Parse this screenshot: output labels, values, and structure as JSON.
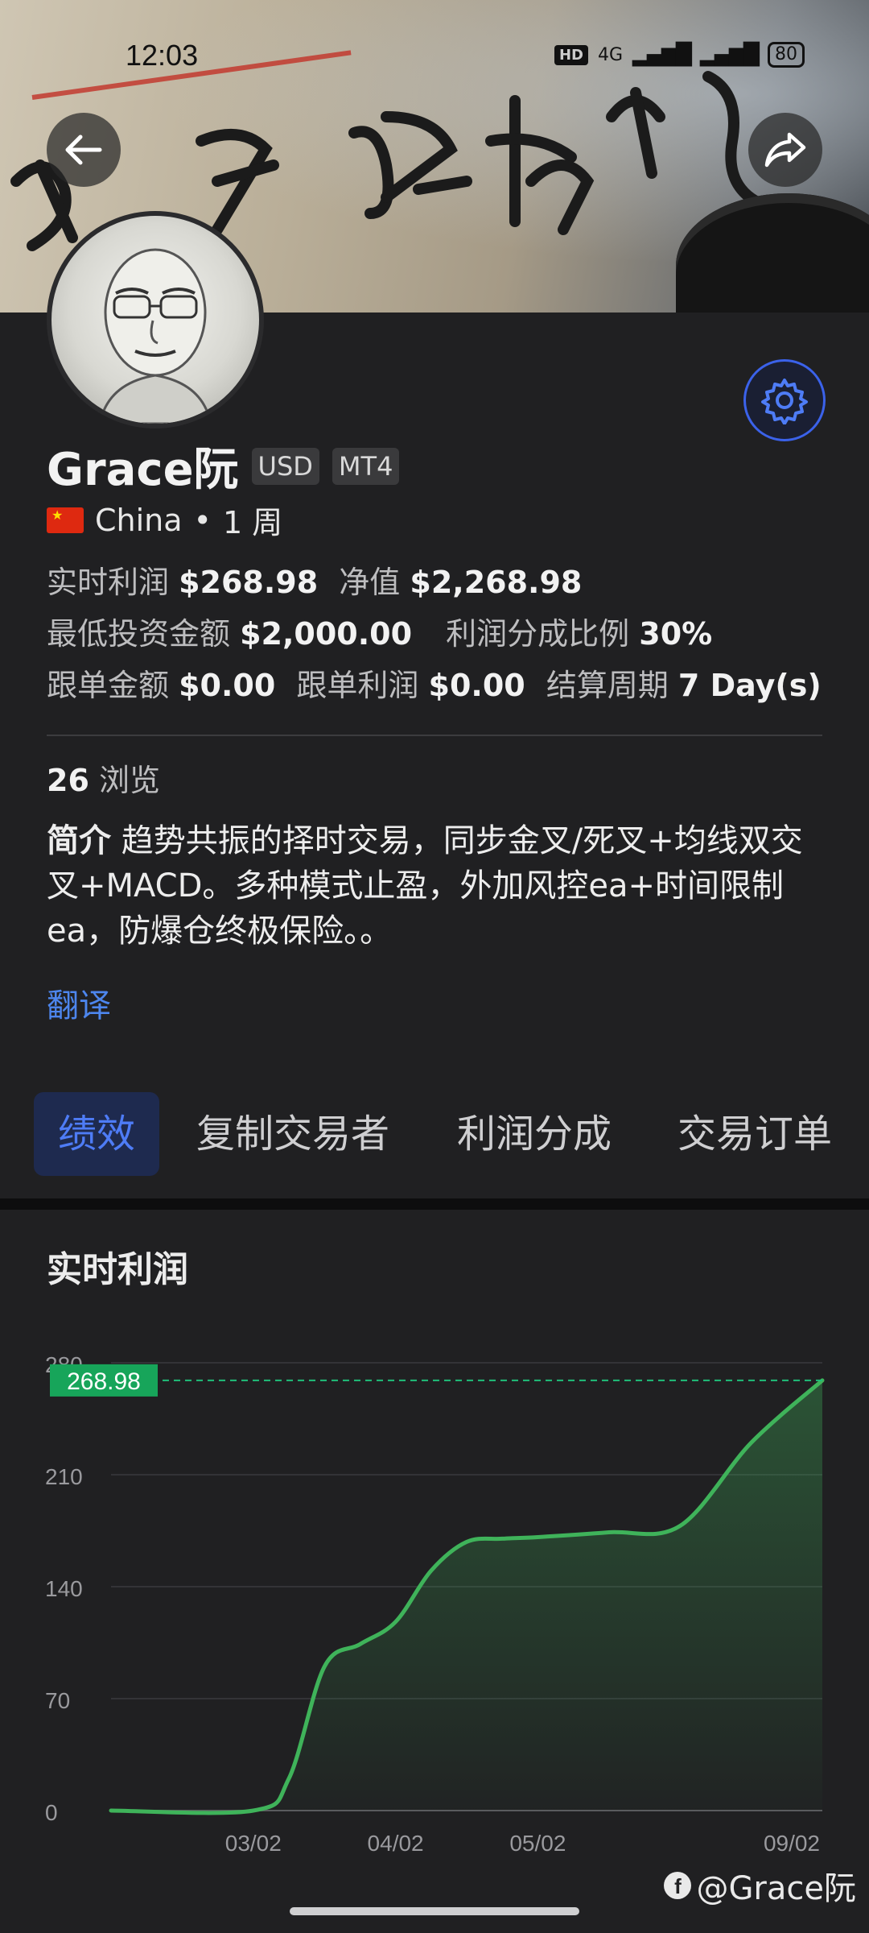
{
  "status_bar": {
    "time": "12:03",
    "network_badge": "HD",
    "signal_label": "4G",
    "battery": "80"
  },
  "profile": {
    "name": "Grace阮",
    "tags": [
      "USD",
      "MT4"
    ],
    "country": "China",
    "separator": "•",
    "duration": "1 周"
  },
  "stats": {
    "realtime_profit_label": "实时利润",
    "realtime_profit_value": "$268.98",
    "equity_label": "净值",
    "equity_value": "$2,268.98",
    "min_invest_label": "最低投资金额",
    "min_invest_value": "$2,000.00",
    "profit_share_label": "利润分成比例",
    "profit_share_value": "30%",
    "copy_amount_label": "跟单金额",
    "copy_amount_value": "$0.00",
    "copy_profit_label": "跟单利润",
    "copy_profit_value": "$0.00",
    "settlement_label": "结算周期",
    "settlement_value": "7 Day(s)"
  },
  "views": {
    "count": "26",
    "label": "浏览"
  },
  "intro": {
    "label": "简介",
    "text": "趋势共振的择时交易，同步金叉/死叉+均线双交叉+MACD。多种模式止盈，外加风控ea+时间限制ea，防爆仓终极保险。。"
  },
  "translate_label": "翻译",
  "tabs": [
    "绩效",
    "复制交易者",
    "利润分成",
    "交易订单"
  ],
  "chart_section_title": "实时利润",
  "colors": {
    "accent": "#4e7cf6",
    "line": "#3fb35a",
    "marker": "#17a55a",
    "background": "#202022"
  },
  "icons": {
    "back": "arrow-left-icon",
    "share": "share-icon",
    "settings": "gear-icon"
  },
  "watermark": "@Grace阮",
  "chart_data": {
    "type": "area",
    "title": "",
    "xlabel": "",
    "ylabel": "",
    "ylim": [
      0,
      280
    ],
    "yticks": [
      "0",
      "70",
      "140",
      "210",
      "280"
    ],
    "xticks": [
      "03/02",
      "04/02",
      "05/02",
      "09/02"
    ],
    "current_value_label": "268.98",
    "current_value": 268.98,
    "series": [
      {
        "x": [
          0,
          0.2,
          0.25,
          0.3,
          0.35,
          0.4,
          0.45,
          0.5,
          0.55,
          0.6,
          0.7,
          0.8,
          0.9,
          1.0
        ],
        "y": [
          0,
          0,
          20,
          90,
          104,
          118,
          150,
          168,
          170,
          171,
          174,
          178,
          230,
          268.98
        ]
      }
    ],
    "grid": true
  }
}
